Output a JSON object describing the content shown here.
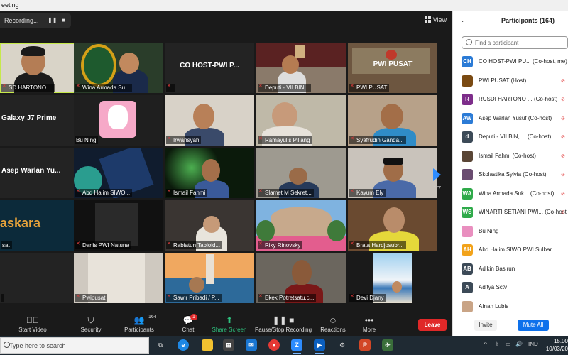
{
  "window": {
    "title": "eeting"
  },
  "recording": {
    "label": "Recording...",
    "pause_icon": "pause-icon",
    "stop_icon": "stop-icon"
  },
  "view": {
    "label": "View",
    "icon": "grid-icon"
  },
  "tiles": [
    {
      "name": "SD  HARTONO ..."
    },
    {
      "name": "Wina Armada Su..."
    },
    {
      "name": "",
      "big": "CO HOST-PWI P..."
    },
    {
      "name": "Deputi - VII BIN..."
    },
    {
      "name": "PWI PUSAT"
    },
    {
      "name": "",
      "big": "Galaxy J7 Prime"
    },
    {
      "name": "Bu Ning"
    },
    {
      "name": "Irwansyah"
    },
    {
      "name": "Ramayulis Piliang"
    },
    {
      "name": "Syafrudin Ganda..."
    },
    {
      "name": "",
      "big": "Asep Warlan Yu..."
    },
    {
      "name": "Abd Halim SIWO..."
    },
    {
      "name": "Ismail Fahmi"
    },
    {
      "name": "Slamet M Sekret..."
    },
    {
      "name": "Kayum Ely"
    },
    {
      "name": "sat",
      "big": "askara"
    },
    {
      "name": "Darlis PWI Natuna"
    },
    {
      "name": "Rabiatun Tabloid..."
    },
    {
      "name": "Riky Rinovsky"
    },
    {
      "name": "Brata Hardjosubr..."
    },
    {
      "name": ""
    },
    {
      "name": "Pwipusat"
    },
    {
      "name": "Sawir Pribadi / P..."
    },
    {
      "name": "Ekek Potretsatu.c..."
    },
    {
      "name": "Devi Djany"
    }
  ],
  "pager": {
    "indicator": "1/7"
  },
  "toolbar": {
    "start_video": "Start Video",
    "security": "Security",
    "participants": "Participants",
    "participants_count": "164",
    "chat": "Chat",
    "chat_badge": "1",
    "share_screen": "Share Screen",
    "pause_stop_recording": "Pause/Stop Recording",
    "reactions": "Reactions",
    "more": "More",
    "leave": "Leave"
  },
  "panel": {
    "title": "Participants (164)",
    "search_placeholder": "Find a participant",
    "invite": "Invite",
    "mute_all": "Mute All",
    "participants": [
      {
        "initials": "CH",
        "color": "#2b7bd6",
        "name": "CO HOST-PWI PU... (Co-host, me)"
      },
      {
        "initials": "",
        "color": "#7a4a12",
        "name": "PWI PUSAT (Host)"
      },
      {
        "initials": "R",
        "color": "#7d2d8a",
        "name": "RUSDI HARTONO ... (Co-host)"
      },
      {
        "initials": "AW",
        "color": "#2b7bd6",
        "name": "Asep Warlan Yusuf (Co-host)"
      },
      {
        "initials": "d",
        "color": "#3c4a57",
        "name": "Deputi - VII BIN, ... (Co-host)"
      },
      {
        "initials": "",
        "color": "#5a4636",
        "name": "Ismail Fahmi (Co-host)"
      },
      {
        "initials": "",
        "color": "#6a4c70",
        "name": "Skolastika Sylvia (Co-host)"
      },
      {
        "initials": "WA",
        "color": "#2faa4a",
        "name": "Wina Armada Suk... (Co-host)"
      },
      {
        "initials": "WS",
        "color": "#2faa4a",
        "name": "WINARTI SETIANI PWI... (Co-host)"
      },
      {
        "initials": "",
        "color": "#e98fbf",
        "name": "Bu Ning"
      },
      {
        "initials": "AH",
        "color": "#f2a31b",
        "name": "Abd Halim SIWO PWI Sulbar"
      },
      {
        "initials": "AB",
        "color": "#3c4a57",
        "name": "Adikin Basirun"
      },
      {
        "initials": "A",
        "color": "#3c4a57",
        "name": "Aditya Sctv"
      },
      {
        "initials": "",
        "color": "#c9a486",
        "name": "Afnan Lubis"
      }
    ]
  },
  "taskbar": {
    "search_placeholder": "Type here to search",
    "lang": "IND",
    "time": "15.00",
    "date": "10/03/20"
  }
}
